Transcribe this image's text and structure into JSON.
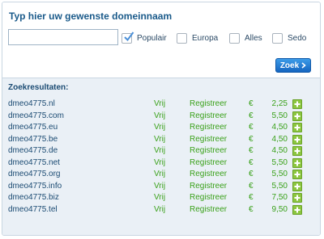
{
  "search": {
    "title": "Typ hier uw gewenste domeinnaam",
    "input_value": "",
    "input_placeholder": "",
    "options": [
      {
        "label": "Populair",
        "checked": true
      },
      {
        "label": "Europa",
        "checked": false
      },
      {
        "label": "Alles",
        "checked": false
      },
      {
        "label": "Sedo",
        "checked": false
      }
    ],
    "submit_label": "Zoek"
  },
  "results": {
    "title": "Zoekresultaten:",
    "rows": [
      {
        "domain": "dmeo4775.nl",
        "status": "Vrij",
        "action": "Registreer",
        "currency": "€",
        "price": "2,25"
      },
      {
        "domain": "dmeo4775.com",
        "status": "Vrij",
        "action": "Registreer",
        "currency": "€",
        "price": "5,50"
      },
      {
        "domain": "dmeo4775.eu",
        "status": "Vrij",
        "action": "Registreer",
        "currency": "€",
        "price": "4,50"
      },
      {
        "domain": "dmeo4775.be",
        "status": "Vrij",
        "action": "Registreer",
        "currency": "€",
        "price": "4,50"
      },
      {
        "domain": "dmeo4775.de",
        "status": "Vrij",
        "action": "Registreer",
        "currency": "€",
        "price": "4,50"
      },
      {
        "domain": "dmeo4775.net",
        "status": "Vrij",
        "action": "Registreer",
        "currency": "€",
        "price": "5,50"
      },
      {
        "domain": "dmeo4775.org",
        "status": "Vrij",
        "action": "Registreer",
        "currency": "€",
        "price": "5,50"
      },
      {
        "domain": "dmeo4775.info",
        "status": "Vrij",
        "action": "Registreer",
        "currency": "€",
        "price": "5,50"
      },
      {
        "domain": "dmeo4775.biz",
        "status": "Vrij",
        "action": "Registreer",
        "currency": "€",
        "price": "7,50"
      },
      {
        "domain": "dmeo4775.tel",
        "status": "Vrij",
        "action": "Registreer",
        "currency": "€",
        "price": "9,50"
      }
    ]
  },
  "icons": {
    "checkmark": "checkmark-icon",
    "zoek_arrow": "chevron-right-icon",
    "add": "plus-icon"
  },
  "colors": {
    "title": "#1a5a8a",
    "available": "#3aa11a",
    "add_button": "#8cc63f",
    "zoek_button": "#1e78d4",
    "results_bg": "#eaf0f6"
  }
}
